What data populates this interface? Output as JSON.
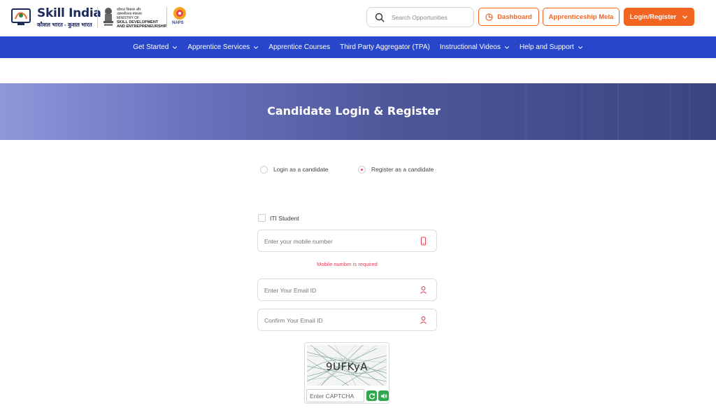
{
  "header": {
    "logo_title": "Skill India",
    "logo_subtitle": "कौशल भारत - कुशल भारत",
    "ministry_lines": [
      "कौशल विकास और",
      "उद्यमशीलता मंत्रालय",
      "MINISTRY OF",
      "SKILL DEVELOPMENT",
      "AND ENTREPRENEURSHIP"
    ],
    "naps_label": "NAPS",
    "search_placeholder": "Search Opportunities",
    "dashboard_label": "Dashboard",
    "mela_label": "Apprenticeship Mela",
    "login_label": "Login/Register"
  },
  "nav": {
    "items": [
      {
        "label": "Get Started",
        "dropdown": true
      },
      {
        "label": "Apprentice Services",
        "dropdown": true
      },
      {
        "label": "Apprentice Courses",
        "dropdown": false
      },
      {
        "label": "Third Party Aggregator (TPA)",
        "dropdown": false
      },
      {
        "label": "Instructional Videos",
        "dropdown": true
      },
      {
        "label": "Help and Support",
        "dropdown": true
      }
    ]
  },
  "banner": {
    "title": "Candidate Login & Register"
  },
  "form": {
    "radio_login_label": "Login as a candidate",
    "radio_register_label": "Register as a candidate",
    "selected_mode": "register",
    "iti_label": "ITI Student",
    "mobile_placeholder": "Enter your mobile number",
    "mobile_error": "Mobile number is required",
    "email_placeholder": "Enter Your Email ID",
    "confirm_email_placeholder": "Confirm Your Email ID",
    "captcha_text": "9UFKyA",
    "captcha_placeholder": "Enter CAPTCHA"
  },
  "colors": {
    "accent": "#f26522",
    "nav_bg": "#2746c9",
    "error": "#e0455b",
    "captcha_btn": "#2ea84a"
  }
}
